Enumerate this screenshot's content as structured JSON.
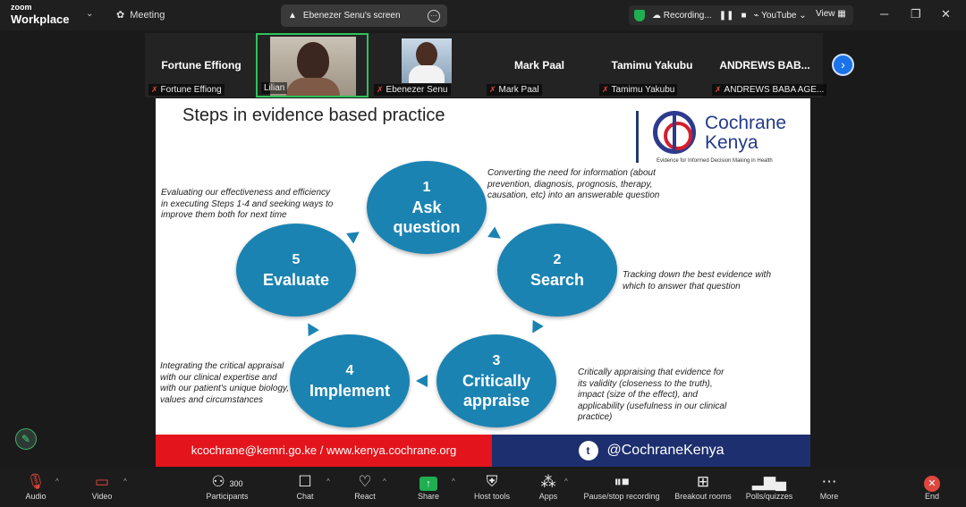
{
  "app": {
    "brand_small": "zoom",
    "brand_big": "Workplace",
    "meeting_label": "Meeting"
  },
  "share": {
    "label": "Ebenezer Senu's screen"
  },
  "status": {
    "recording_label": "Recording...",
    "youtube_label": "YouTube",
    "view_label": "View"
  },
  "participants_strip": [
    {
      "name": "Fortune Effiong",
      "label": "Fortune Effiong",
      "muted": true,
      "video": false
    },
    {
      "name": "",
      "label": "Lilian",
      "muted": false,
      "video": true,
      "active": true
    },
    {
      "name": "",
      "label": "Ebenezer Senu",
      "muted": true,
      "video": true
    },
    {
      "name": "Mark Paal",
      "label": "Mark Paal",
      "muted": true,
      "video": false
    },
    {
      "name": "Tamimu Yakubu",
      "label": "Tamimu Yakubu",
      "muted": true,
      "video": false
    },
    {
      "name": "ANDREWS BAB...",
      "label": "ANDREWS BABA AGE...",
      "muted": true,
      "video": false
    }
  ],
  "slide": {
    "title": "Steps in evidence based practice",
    "logo": {
      "line1": "Cochrane",
      "line2": "Kenya",
      "tagline": "Evidence for Informed Decision Making in Health"
    },
    "steps": [
      {
        "num": "1",
        "line1": "Ask",
        "line2": "question"
      },
      {
        "num": "2",
        "line1": "Search",
        "line2": ""
      },
      {
        "num": "3",
        "line1": "Critically",
        "line2": "appraise"
      },
      {
        "num": "4",
        "line1": "Implement",
        "line2": ""
      },
      {
        "num": "5",
        "line1": "Evaluate",
        "line2": ""
      }
    ],
    "notes": {
      "ask": "Converting the need for information (about prevention, diagnosis, prognosis, therapy, causation, etc) into an answerable question",
      "search": "Tracking down the best evidence with which to answer that question",
      "appraise": "Critically appraising that evidence for its validity (closeness to the truth), impact (size of the effect), and applicability (usefulness in our clinical practice)",
      "implement": "Integrating the critical appraisal with our clinical expertise and with our patient's unique biology, values and circumstances",
      "evaluate": "Evaluating our effectiveness and efficiency in executing Steps 1-4 and seeking ways to improve them both for next time"
    },
    "footer_left": "kcochrane@kemri.go.ke  /  www.kenya.cochrane.org",
    "footer_right": "@CochraneKenya"
  },
  "toolbar": {
    "audio": "Audio",
    "video": "Video",
    "participants": "Participants",
    "participants_count": "300",
    "chat": "Chat",
    "react": "React",
    "share": "Share",
    "host_tools": "Host tools",
    "apps": "Apps",
    "recording": "Pause/stop recording",
    "breakout": "Breakout rooms",
    "polls": "Polls/quizzes",
    "more": "More",
    "end": "End"
  }
}
